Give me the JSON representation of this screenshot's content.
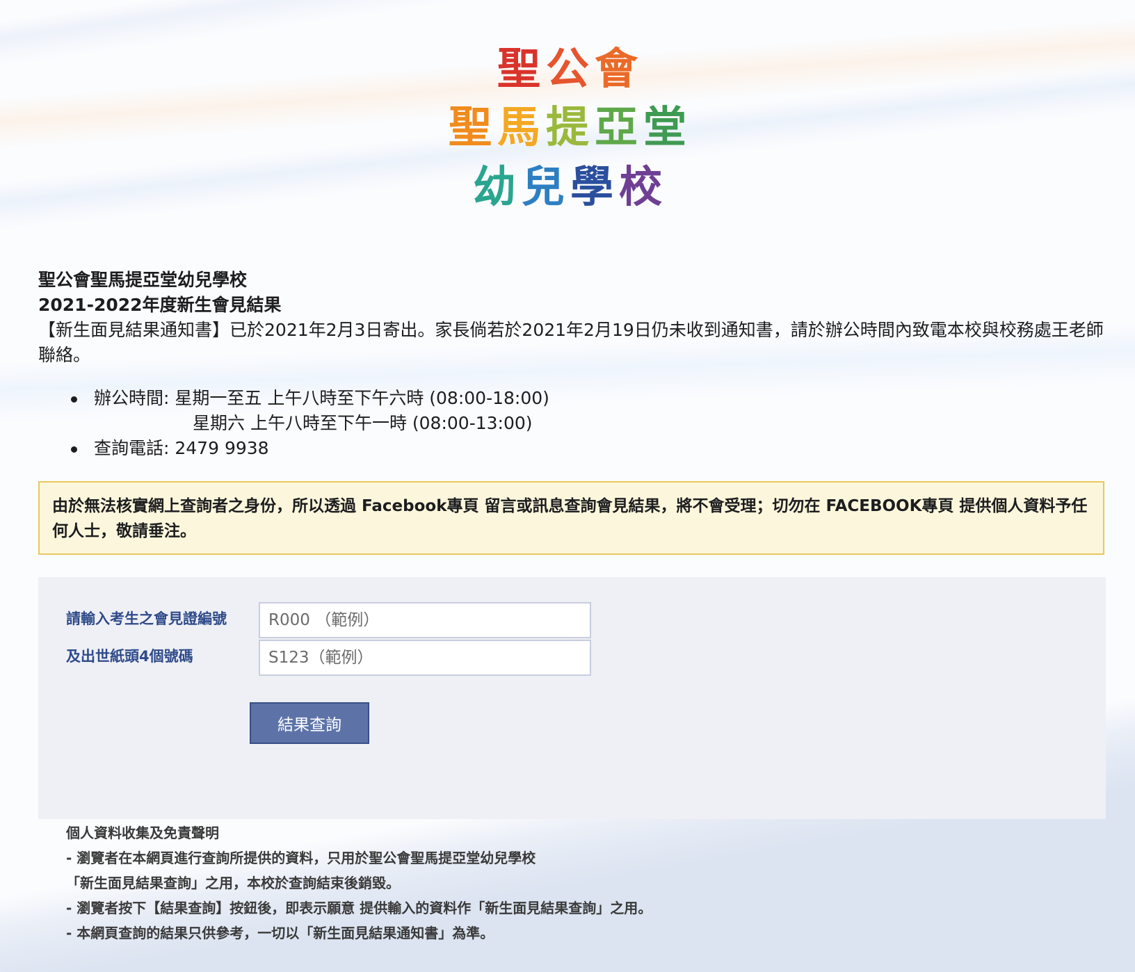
{
  "logo": {
    "row1": [
      {
        "char": "聖",
        "color": "#d9342b"
      },
      {
        "char": "公",
        "color": "#e5552e"
      },
      {
        "char": "會",
        "color": "#ea6a28"
      }
    ],
    "row2": [
      {
        "char": "聖",
        "color": "#f08c1e"
      },
      {
        "char": "馬",
        "color": "#f4a823"
      },
      {
        "char": "提",
        "color": "#9ab93c"
      },
      {
        "char": "亞",
        "color": "#5fa84a"
      },
      {
        "char": "堂",
        "color": "#3f9a52"
      }
    ],
    "row3": [
      {
        "char": "幼",
        "color": "#2aa58f"
      },
      {
        "char": "兒",
        "color": "#2d7fc1"
      },
      {
        "char": "學",
        "color": "#2b4f9e"
      },
      {
        "char": "校",
        "color": "#6e3f94"
      }
    ]
  },
  "header": {
    "school_name": "聖公會聖馬提亞堂幼兒學校",
    "result_title": "2021-2022年度新生會見結果"
  },
  "intro": "【新生面見結果通知書】已於2021年2月3日寄出。家長倘若於2021年2月19日仍未收到通知書，請於辦公時間內致電本校與校務處王老師聯絡。",
  "info": {
    "office_hours_line1": "辦公時間: 星期一至五 上午八時至下午六時 (08:00-18:00)",
    "office_hours_line2": "星期六 上午八時至下午一時 (08:00-13:00)",
    "phone": "查詢電話: 2479 9938"
  },
  "warning": "由於無法核實網上查詢者之身份，所以透過 Facebook專頁 留言或訊息查詢會見結果，將不會受理；切勿在 FACEBOOK專頁 提供個人資料予任何人士，敬請垂注。",
  "form": {
    "label_interview_no": "請輸入考生之會見證編號",
    "label_birth_cert": "及出世紙頭4個號碼",
    "interview_no_placeholder": "R000 （範例）",
    "birth_cert_placeholder": "S123（範例）",
    "submit_label": "結果查詢"
  },
  "disclaimer": {
    "title": "個人資料收集及免責聲明",
    "line1": "- 瀏覽者在本網頁進行查詢所提供的資料，只用於聖公會聖馬提亞堂幼兒學校",
    "line2": "「新生面見結果查詢」之用，本校於查詢結束後銷毀。",
    "line3": "- 瀏覽者按下【結果查詢】按鈕後，即表示願意 提供輸入的資料作「新生面見結果查詢」之用。",
    "line4": "- 本網頁查詢的結果只供參考，一切以「新生面見結果通知書」為準。"
  }
}
